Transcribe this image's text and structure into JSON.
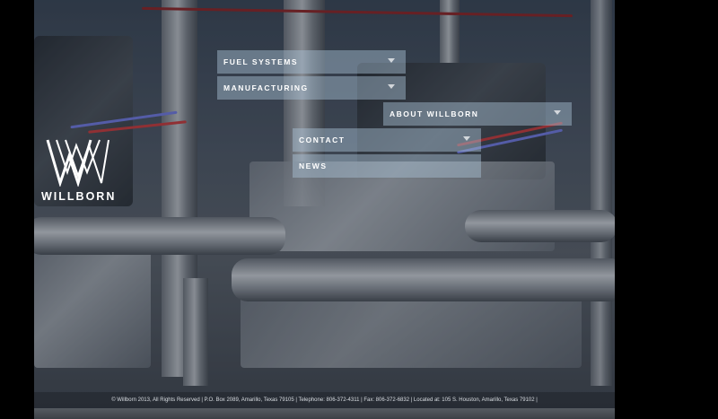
{
  "brand": {
    "name": "WILLBORN"
  },
  "nav": [
    {
      "label": "FUEL SYSTEMS"
    },
    {
      "label": "MANUFACTURING"
    },
    {
      "label": "ABOUT WILLBORN"
    },
    {
      "label": "CONTACT"
    },
    {
      "label": "NEWS"
    }
  ],
  "footer": {
    "text": "© Willborn 2013, All Rights Reserved | P.O. Box 2089, Amarillo, Texas  79105 | Telephone: 806-372-4311 | Fax: 806-372-6832 | Located at: 105 S. Houston, Amarillo, Texas  79102 |"
  },
  "colors": {
    "nav_bg": "#aac3d7",
    "background": "#000000"
  }
}
